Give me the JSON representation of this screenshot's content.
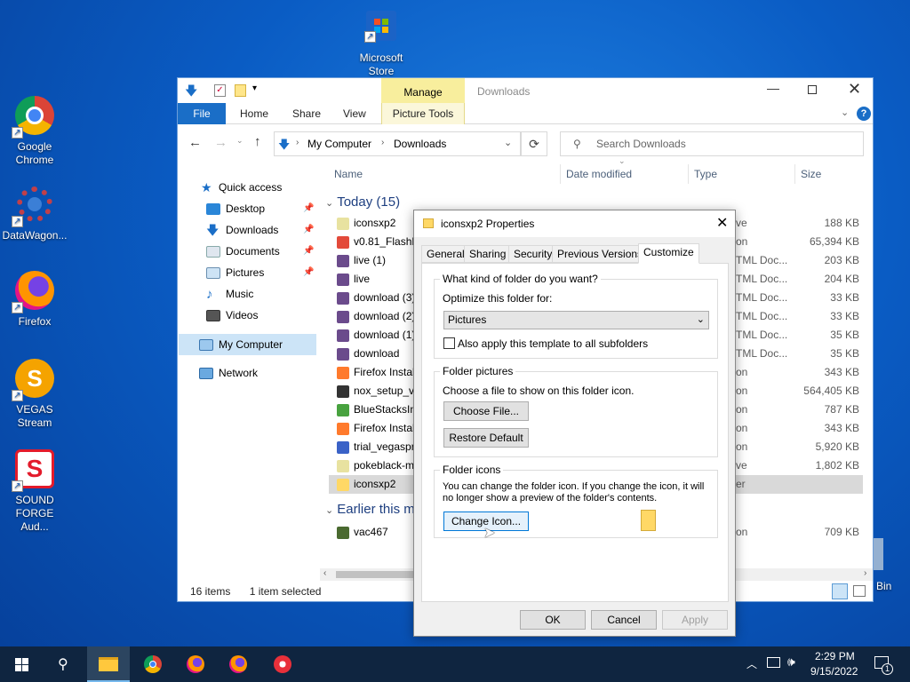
{
  "desktop": {
    "icons": [
      {
        "label": "Microsoft Store"
      },
      {
        "label": "Google Chrome"
      },
      {
        "label": "DataWagon..."
      },
      {
        "label": "Firefox"
      },
      {
        "label": "VEGAS Stream"
      },
      {
        "label": "SOUND FORGE Aud..."
      },
      {
        "label": "Bin"
      }
    ]
  },
  "explorer": {
    "title": "Downloads",
    "manage_tab": "Manage",
    "ribbon_tabs": [
      "File",
      "Home",
      "Share",
      "View",
      "Picture Tools"
    ],
    "breadcrumb": [
      "My Computer",
      "Downloads"
    ],
    "search_placeholder": "Search Downloads",
    "nav": {
      "quick_access": "Quick access",
      "items": [
        "Desktop",
        "Downloads",
        "Documents",
        "Pictures",
        "Music",
        "Videos"
      ],
      "my_computer": "My Computer",
      "network": "Network"
    },
    "columns": [
      "Name",
      "Date modified",
      "Type",
      "Size"
    ],
    "group_today": "Today (15)",
    "group_earlier": "Earlier this m",
    "files": [
      {
        "name": "iconsxp2",
        "type": "ve",
        "size": "188 KB"
      },
      {
        "name": "v0.81_FlashB",
        "type": "on",
        "size": "65,394 KB"
      },
      {
        "name": "live (1)",
        "type": "TML Doc...",
        "size": "203 KB"
      },
      {
        "name": "live",
        "type": "TML Doc...",
        "size": "204 KB"
      },
      {
        "name": "download (3)",
        "type": "TML Doc...",
        "size": "33 KB"
      },
      {
        "name": "download (2)",
        "type": "TML Doc...",
        "size": "33 KB"
      },
      {
        "name": "download (1)",
        "type": "TML Doc...",
        "size": "35 KB"
      },
      {
        "name": "download",
        "type": "TML Doc...",
        "size": "35 KB"
      },
      {
        "name": "Firefox Instal",
        "type": "on",
        "size": "343 KB"
      },
      {
        "name": "nox_setup_v7",
        "type": "on",
        "size": "564,405 KB"
      },
      {
        "name": "BlueStacksIns",
        "type": "on",
        "size": "787 KB"
      },
      {
        "name": "Firefox Instal",
        "type": "on",
        "size": "343 KB"
      },
      {
        "name": "trial_vegaspro",
        "type": "on",
        "size": "5,920 KB"
      },
      {
        "name": "pokeblack-m",
        "type": "ve",
        "size": "1,802 KB"
      },
      {
        "name": "iconsxp2",
        "type": "er",
        "size": ""
      }
    ],
    "earlier_files": [
      {
        "name": "vac467",
        "type": "on",
        "size": "709 KB"
      }
    ],
    "status_items": "16 items",
    "status_selected": "1 item selected"
  },
  "dialog": {
    "title": "iconsxp2 Properties",
    "tabs": [
      "General",
      "Sharing",
      "Security",
      "Previous Versions",
      "Customize"
    ],
    "kind_group": "What kind of folder do you want?",
    "optimize_label": "Optimize this folder for:",
    "optimize_value": "Pictures",
    "subfolders_checkbox": "Also apply this template to all subfolders",
    "pictures_group": "Folder pictures",
    "pictures_desc": "Choose a file to show on this folder icon.",
    "choose_file": "Choose File...",
    "restore_default": "Restore Default",
    "icons_group": "Folder icons",
    "icons_desc": "You can change the folder icon. If you change the icon, it will no longer show a preview of the folder's contents.",
    "change_icon": "Change Icon...",
    "ok": "OK",
    "cancel": "Cancel",
    "apply": "Apply"
  },
  "taskbar": {
    "time": "2:29 PM",
    "date": "9/15/2022",
    "notification_count": "1"
  }
}
